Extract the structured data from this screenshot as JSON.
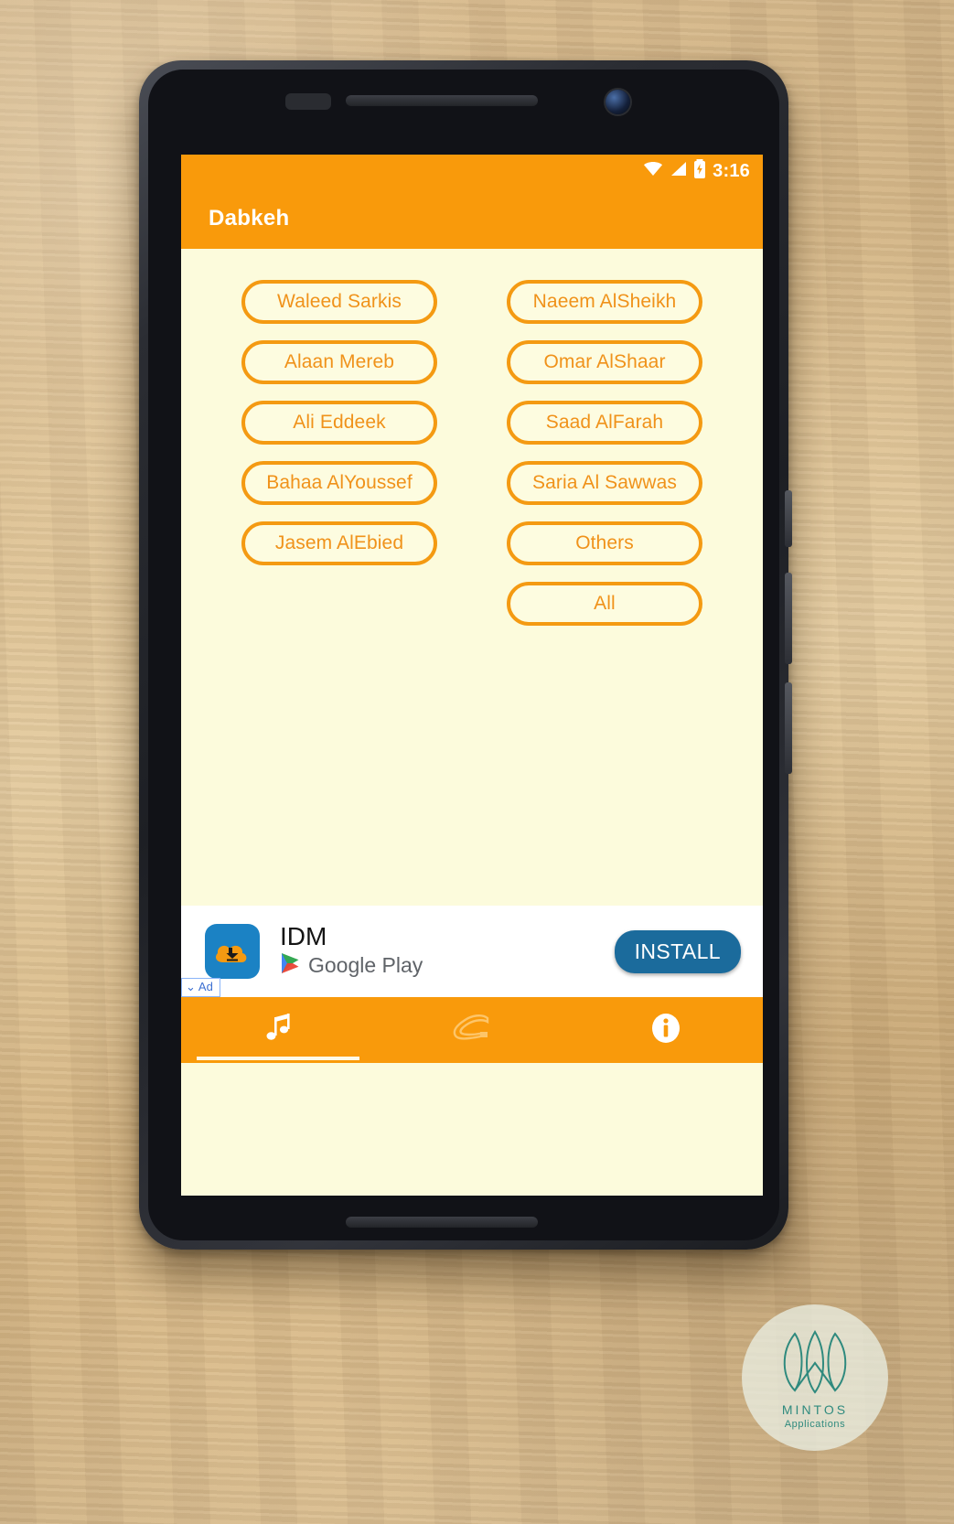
{
  "statusbar": {
    "time": "3:16",
    "icons": [
      "wifi-icon",
      "signal-icon",
      "battery-charging-icon"
    ]
  },
  "appbar": {
    "title": "Dabkeh"
  },
  "theme": {
    "accent": "#f99a0b",
    "button_border": "#f49a12",
    "button_text": "#f0921a",
    "content_bg": "#fcfbdc",
    "install_button": "#1b6b9c"
  },
  "content": {
    "columns": [
      {
        "buttons": [
          {
            "label": "Waleed Sarkis"
          },
          {
            "label": "Alaan Mereb"
          },
          {
            "label": "Ali Eddeek"
          },
          {
            "label": "Bahaa AlYoussef"
          },
          {
            "label": "Jasem AlEbied"
          }
        ]
      },
      {
        "buttons": [
          {
            "label": "Naeem AlSheikh"
          },
          {
            "label": "Omar AlShaar"
          },
          {
            "label": "Saad AlFarah"
          },
          {
            "label": "Saria Al Sawwas"
          },
          {
            "label": "Others"
          },
          {
            "label": "All"
          }
        ]
      }
    ]
  },
  "ad": {
    "badge": "Ad",
    "badge_chevron": "⌄",
    "app_name": "IDM",
    "store": "Google Play",
    "install_label": "INSTALL",
    "icon": "idm-cloud-download-icon"
  },
  "bottomnav": {
    "items": [
      {
        "name": "music-note-icon",
        "active": true
      },
      {
        "name": "dabkeh-shoe-icon",
        "active": false
      },
      {
        "name": "info-icon",
        "active": false
      }
    ]
  },
  "watermark": {
    "name": "MINTOS",
    "subtitle": "Applications"
  }
}
